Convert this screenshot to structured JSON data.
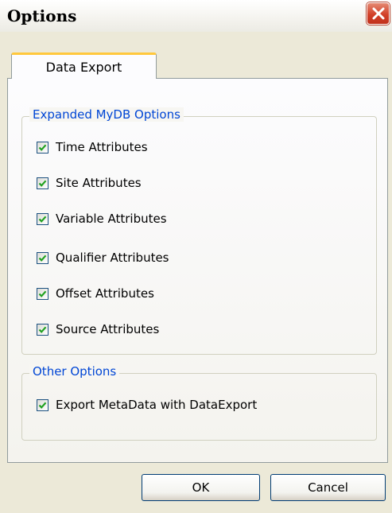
{
  "window": {
    "title": "Options"
  },
  "tabs": [
    {
      "label": "Data Export",
      "selected": true
    }
  ],
  "groups": [
    {
      "legend": "Expanded MyDB Options",
      "items": [
        {
          "label": "Time Attributes",
          "checked": true
        },
        {
          "label": "Site Attributes",
          "checked": true
        },
        {
          "label": "Variable Attributes",
          "checked": true
        },
        {
          "label": "Qualifier Attributes",
          "checked": true
        },
        {
          "label": "Offset Attributes",
          "checked": true
        },
        {
          "label": "Source Attributes",
          "checked": true
        }
      ]
    },
    {
      "legend": "Other Options",
      "items": [
        {
          "label": "Export MetaData with DataExport",
          "checked": true
        }
      ]
    }
  ],
  "buttons": {
    "ok": "OK",
    "cancel": "Cancel"
  },
  "colors": {
    "accent": "#0046d5",
    "checkmark": "#21a121",
    "close": "#d2412a",
    "tab_highlight": "#ffc83c"
  },
  "icons": {
    "close": "close-icon",
    "check": "checkmark-icon"
  }
}
